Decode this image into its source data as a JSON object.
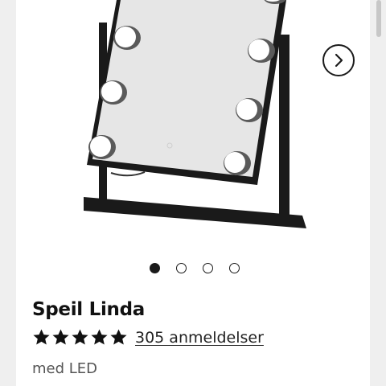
{
  "product": {
    "title": "Speil Linda",
    "rating_stars": 5,
    "reviews_link": "305 anmeldelser",
    "subtitle": "med LED"
  },
  "carousel": {
    "slide_count": 4,
    "active_index": 0,
    "next_icon": "chevron-right-icon"
  },
  "image": {
    "subject": "mirror-icon"
  },
  "colors": {
    "page_background": "#efefef",
    "card_background": "#ffffff",
    "text": "#111111",
    "frame": "#1a1a1a"
  }
}
